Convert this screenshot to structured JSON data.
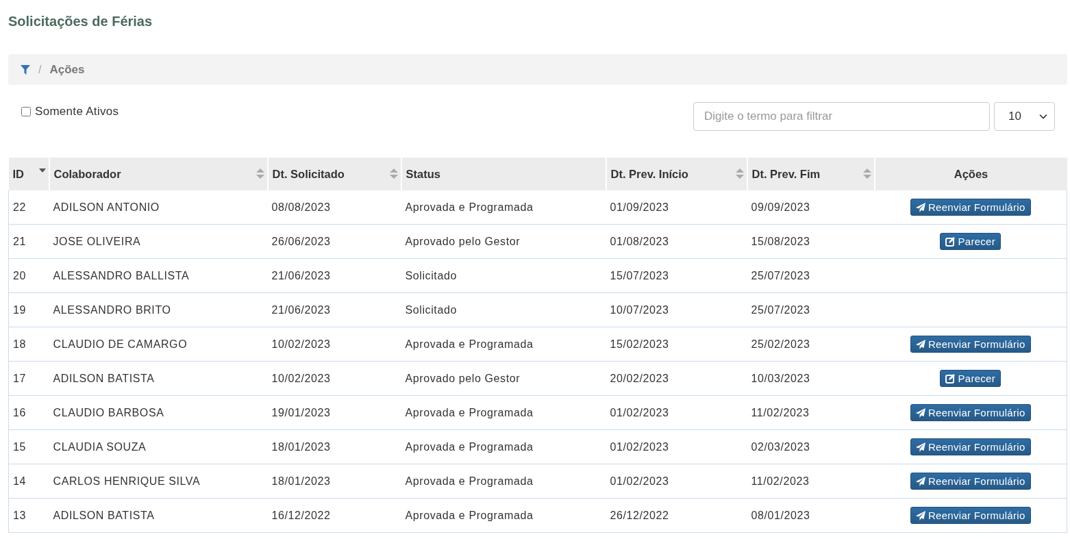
{
  "page_title": "Solicitações de Férias",
  "breadcrumb": {
    "separator": "/",
    "label": "Ações"
  },
  "filter_checkbox": {
    "label": "Somente Ativos",
    "checked": false
  },
  "search": {
    "placeholder": "Digite o termo para filtrar"
  },
  "page_size": {
    "value": "10"
  },
  "table": {
    "columns": [
      {
        "label": "ID",
        "kind": "data",
        "sortable": true,
        "sorted": true
      },
      {
        "label": "Colaborador",
        "kind": "data",
        "sortable": true,
        "sorted": false
      },
      {
        "label": "Dt. Solicitado",
        "kind": "data",
        "sortable": true,
        "sorted": false
      },
      {
        "label": "Status",
        "kind": "data",
        "sortable": false,
        "sorted": false
      },
      {
        "label": "Dt. Prev. Início",
        "kind": "data",
        "sortable": true,
        "sorted": false
      },
      {
        "label": "Dt. Prev. Fim",
        "kind": "data",
        "sortable": true,
        "sorted": false
      },
      {
        "label": "Ações",
        "kind": "actions",
        "sortable": false,
        "sorted": false
      }
    ],
    "rows": [
      {
        "cells": [
          "22",
          "ADILSON ANTONIO",
          "08/08/2023",
          "Aprovada e Programada",
          "01/09/2023",
          "09/09/2023"
        ],
        "action": {
          "kind": "resend",
          "label": "Reenviar Formulário"
        }
      },
      {
        "cells": [
          "21",
          "JOSE OLIVEIRA",
          "26/06/2023",
          "Aprovado pelo Gestor",
          "01/08/2023",
          "15/08/2023"
        ],
        "action": {
          "kind": "review",
          "label": "Parecer"
        }
      },
      {
        "cells": [
          "20",
          "ALESSANDRO BALLISTA",
          "21/06/2023",
          "Solicitado",
          "15/07/2023",
          "25/07/2023"
        ]
      },
      {
        "cells": [
          "19",
          "ALESSANDRO BRITO",
          "21/06/2023",
          "Solicitado",
          "10/07/2023",
          "25/07/2023"
        ]
      },
      {
        "cells": [
          "18",
          "CLAUDIO DE CAMARGO",
          "10/02/2023",
          "Aprovada e Programada",
          "15/02/2023",
          "25/02/2023"
        ],
        "action": {
          "kind": "resend",
          "label": "Reenviar Formulário"
        }
      },
      {
        "cells": [
          "17",
          "ADILSON BATISTA",
          "10/02/2023",
          "Aprovado pelo Gestor",
          "20/02/2023",
          "10/03/2023"
        ],
        "action": {
          "kind": "review",
          "label": "Parecer"
        }
      },
      {
        "cells": [
          "16",
          "CLAUDIO BARBOSA",
          "19/01/2023",
          "Aprovada e Programada",
          "01/02/2023",
          "11/02/2023"
        ],
        "action": {
          "kind": "resend",
          "label": "Reenviar Formulário"
        }
      },
      {
        "cells": [
          "15",
          "CLAUDIA SOUZA",
          "18/01/2023",
          "Aprovada e Programada",
          "01/02/2023",
          "02/03/2023"
        ],
        "action": {
          "kind": "resend",
          "label": "Reenviar Formulário"
        }
      },
      {
        "cells": [
          "14",
          "CARLOS HENRIQUE SILVA",
          "18/01/2023",
          "Aprovada e Programada",
          "01/02/2023",
          "11/02/2023"
        ],
        "action": {
          "kind": "resend",
          "label": "Reenviar Formulário"
        }
      },
      {
        "cells": [
          "13",
          "ADILSON BATISTA",
          "16/12/2022",
          "Aprovada e Programada",
          "26/12/2022",
          "08/01/2023"
        ],
        "action": {
          "kind": "resend",
          "label": "Reenviar Formulário"
        }
      }
    ]
  }
}
